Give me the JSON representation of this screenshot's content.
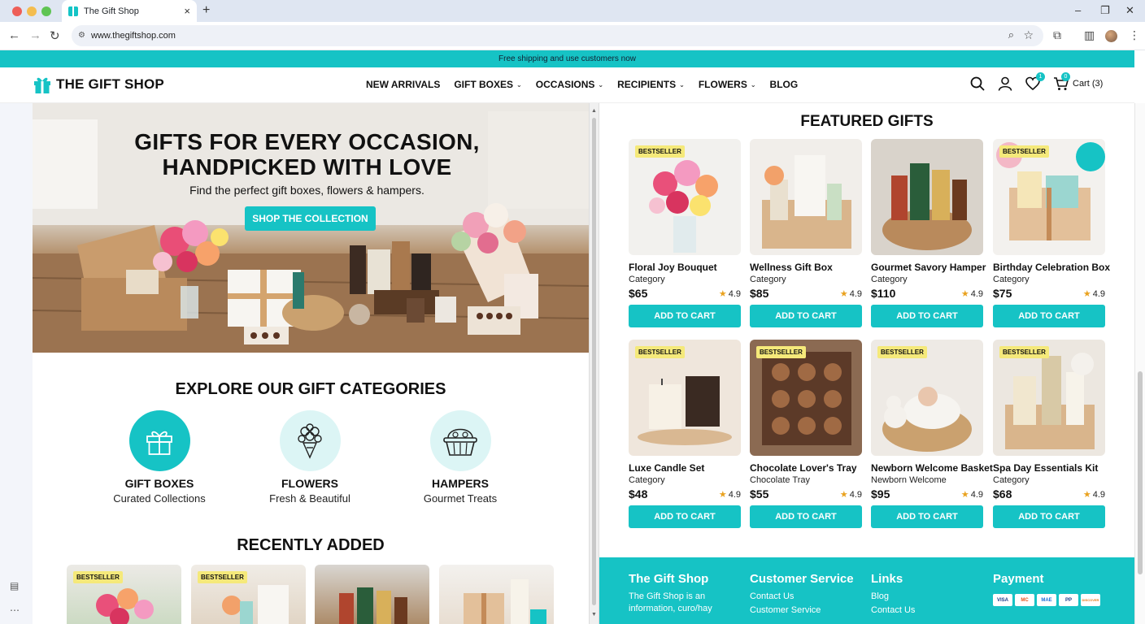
{
  "browser": {
    "tab_title": "The Gift Shop",
    "url": "www.thegiftshop.com",
    "new_tab": "+",
    "close_tab": "×"
  },
  "announcement": "Free shipping and use customers now",
  "header": {
    "logo": "THE GIFT SHOP",
    "nav": [
      {
        "label": "NEW ARRIVALS",
        "dropdown": false
      },
      {
        "label": "GIFT BOXES",
        "dropdown": true
      },
      {
        "label": "OCCASIONS",
        "dropdown": true
      },
      {
        "label": "RECIPIENTS",
        "dropdown": true
      },
      {
        "label": "FLOWERS",
        "dropdown": true
      },
      {
        "label": "BLOG",
        "dropdown": false
      }
    ],
    "wishlist_count": "1",
    "cart_count": "0",
    "cart_label": "Cart (3)"
  },
  "hero": {
    "title_line1": "GIFTS FOR EVERY OCCASION,",
    "title_line2": "HANDPICKED WITH LOVE",
    "subtitle": "Find the perfect gift boxes, flowers & hampers.",
    "cta": "SHOP THE COLLECTION"
  },
  "categories": {
    "title": "EXPLORE OUR GIFT CATEGORIES",
    "items": [
      {
        "name": "GIFT BOXES",
        "sub": "Curated Collections",
        "icon": "gift-icon"
      },
      {
        "name": "FLOWERS",
        "sub": "Fresh & Beautiful",
        "icon": "bouquet-icon"
      },
      {
        "name": "HAMPERS",
        "sub": "Gourmet Treats",
        "icon": "basket-icon"
      }
    ]
  },
  "recent": {
    "title": "RECENTLY ADDED",
    "badges": [
      "BESTSELLER",
      "BESTSELLER",
      "",
      ""
    ]
  },
  "featured": {
    "title": "FEATURED GIFTS",
    "star": "★",
    "products": [
      {
        "badge": "BESTSELLER",
        "name": "Floral Joy Bouquet",
        "category": "Category",
        "price": "$65",
        "rating": "4.9",
        "button": "ADD TO CART"
      },
      {
        "badge": "",
        "name": "Wellness Gift Box",
        "category": "Category",
        "price": "$85",
        "rating": "4.9",
        "button": "ADD TO CART"
      },
      {
        "badge": "",
        "name": "Gourmet Savory Hamper",
        "category": "Category",
        "price": "$110",
        "rating": "4.9",
        "button": "ADD TO CART"
      },
      {
        "badge": "BESTSELLER",
        "name": "Birthday Celebration Box",
        "category": "Category",
        "price": "$75",
        "rating": "4.9",
        "button": "ADD TO CART"
      },
      {
        "badge": "BESTSELLER",
        "name": "Luxe Candle Set",
        "category": "Category",
        "price": "$48",
        "rating": "4.9",
        "button": "ADD TO CART"
      },
      {
        "badge": "BESTSELLER",
        "name": "Chocolate Lover's Tray",
        "category": "Chocolate Tray",
        "price": "$55",
        "rating": "4.9",
        "button": "ADD TO CART"
      },
      {
        "badge": "BESTSELLER",
        "name": "Newborn Welcome Basket",
        "category": "Newborn Welcome",
        "price": "$95",
        "rating": "4.9",
        "button": "ADD TO CART"
      },
      {
        "badge": "BESTSELLER",
        "name": "Spa Day Essentials Kit",
        "category": "Category",
        "price": "$68",
        "rating": "4.9",
        "button": "ADD TO CART"
      }
    ]
  },
  "footer": {
    "col1": {
      "heading": "The Gift Shop",
      "text": "The Gift Shop is an information, curo/hay"
    },
    "col2": {
      "heading": "Customer Service",
      "links": [
        "Contact Us",
        "Customer Service"
      ]
    },
    "col3": {
      "heading": "Links",
      "links": [
        "Blog",
        "Contact Us"
      ]
    },
    "col4": {
      "heading": "Payment",
      "cards": [
        "VISA",
        "MC",
        "MAE",
        "PP",
        "DISCOVER"
      ]
    }
  },
  "colors": {
    "accent": "#16c3c5",
    "badge": "#f5e97a",
    "star": "#e9a21f"
  }
}
